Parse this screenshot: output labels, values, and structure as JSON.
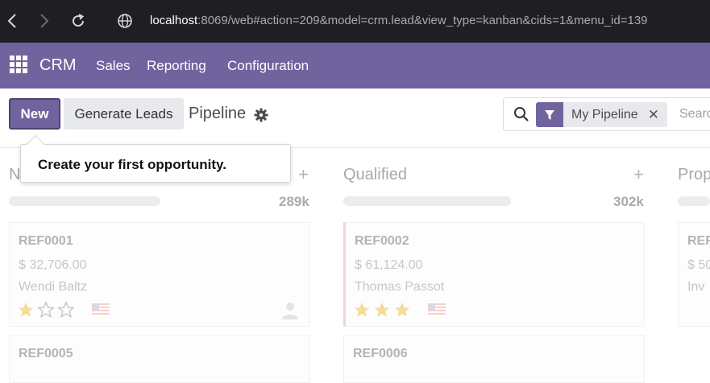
{
  "browser": {
    "url_host": "localhost",
    "url_rest": ":8069/web#action=209&model=crm.lead&view_type=kanban&cids=1&menu_id=139"
  },
  "navbar": {
    "app_name": "CRM",
    "menu": [
      "Sales",
      "Reporting",
      "Configuration"
    ],
    "bg_color": "#71639e"
  },
  "control_panel": {
    "new_label": "New",
    "generate_label": "Generate Leads",
    "breadcrumb": "Pipeline",
    "search": {
      "facet_label": "My Pipeline",
      "placeholder": "Search..."
    }
  },
  "tooltip": {
    "text": "Create your first opportunity."
  },
  "kanban": {
    "columns": [
      {
        "title": "New",
        "total": "289k",
        "cards": [
          {
            "ref": "REF0001",
            "amount": "$ 32,706.00",
            "customer": "Wendi Baltz",
            "stars": 1
          },
          {
            "ref": "REF0005"
          }
        ]
      },
      {
        "title": "Qualified",
        "total": "302k",
        "cards": [
          {
            "ref": "REF0002",
            "amount": "$ 61,124.00",
            "customer": "Thomas Passot",
            "stars": 3
          },
          {
            "ref": "REF0006"
          }
        ]
      },
      {
        "title": "Prop",
        "cards": [
          {
            "ref": "REF",
            "amount": "$ 50",
            "customer": "Inv"
          }
        ]
      }
    ]
  },
  "icons": {
    "back": "chevron-left-icon",
    "forward": "chevron-right-icon",
    "reload": "reload-icon",
    "site_info": "globe-icon",
    "apps": "apps-grid-icon",
    "settings": "gear-icon",
    "search": "search-icon",
    "filter": "filter-icon",
    "close": "close-icon",
    "add": "plus-icon",
    "star": "star-icon",
    "flag": "us-flag-icon",
    "avatar": "user-avatar-icon"
  }
}
